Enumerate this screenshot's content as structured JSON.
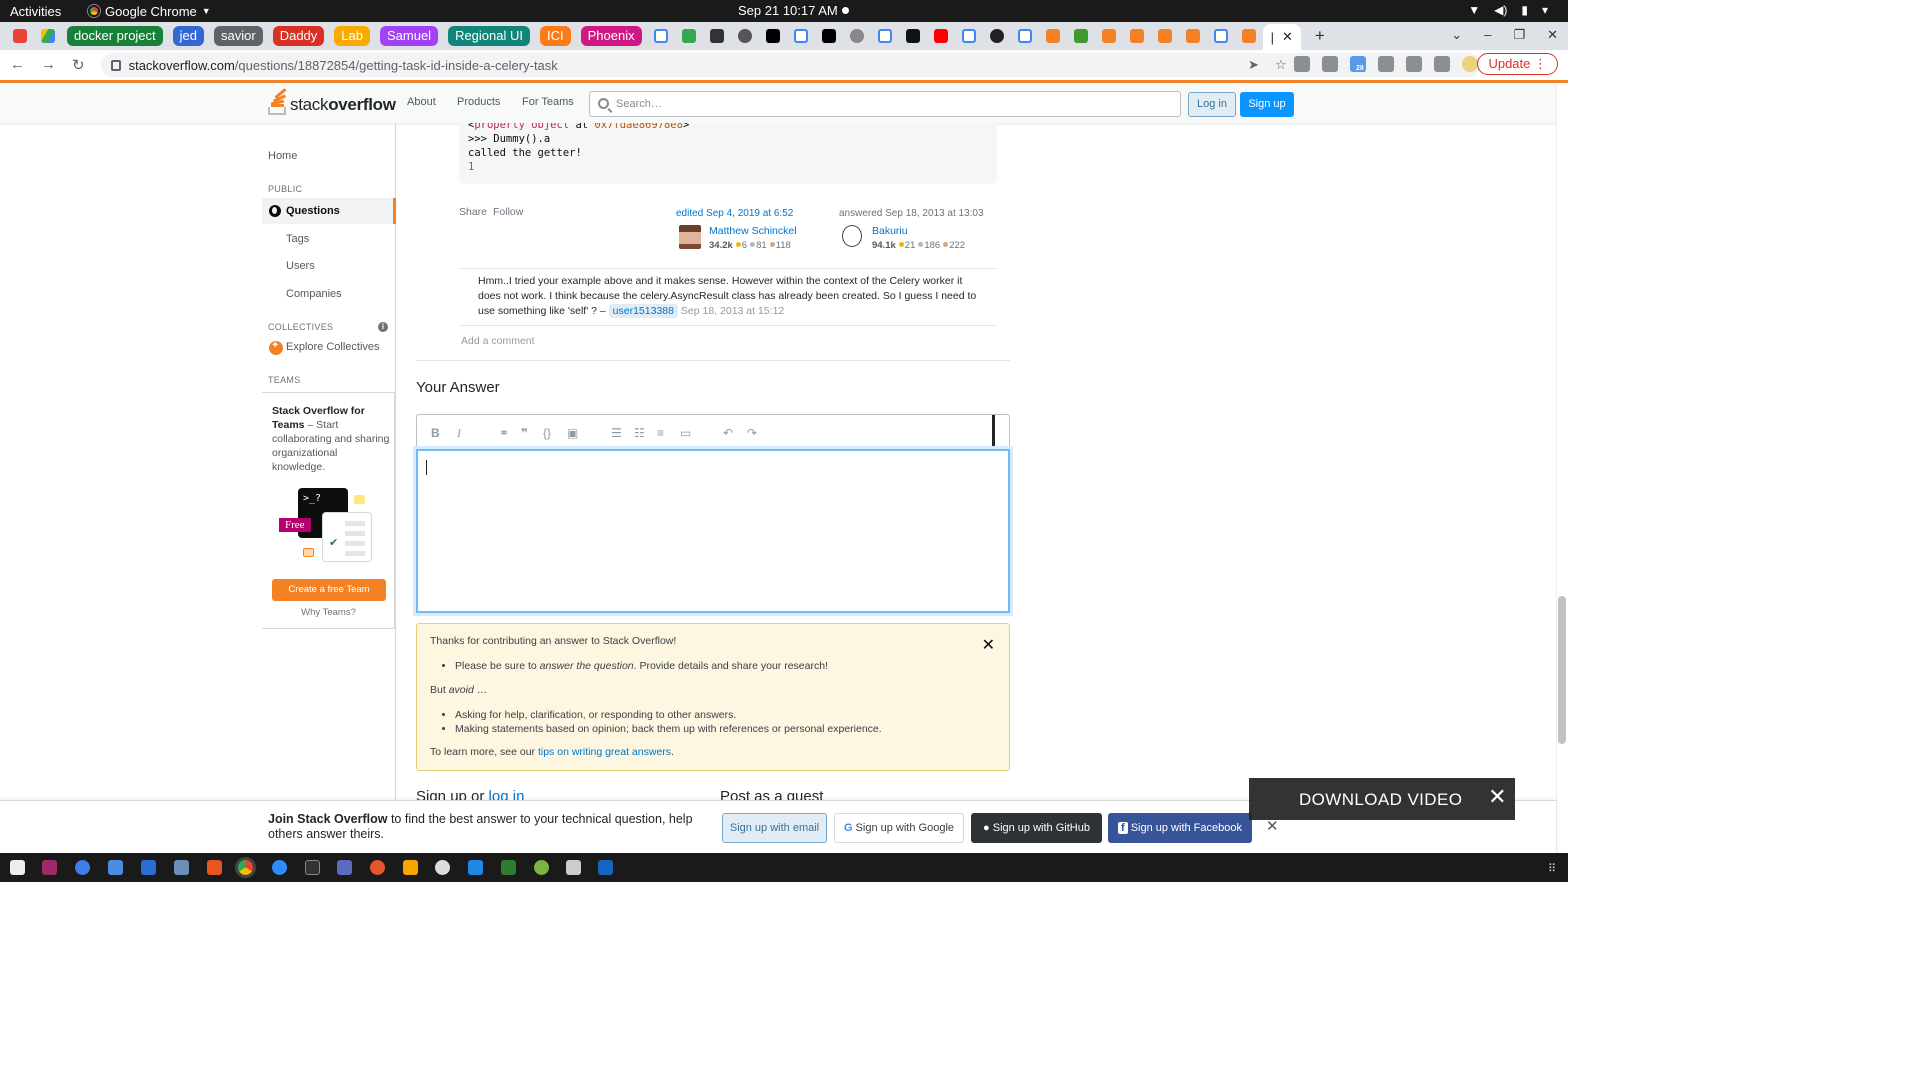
{
  "system": {
    "activities": "Activities",
    "app_name": "Google Chrome",
    "clock": "Sep 21  10:17 AM"
  },
  "browser": {
    "tab_groups": [
      {
        "label": "docker project",
        "color": "#188038"
      },
      {
        "label": "jed",
        "color": "#3367d6"
      },
      {
        "label": "savior",
        "color": "#5f6368"
      },
      {
        "label": "Daddy",
        "color": "#d93025"
      },
      {
        "label": "Lab",
        "color": "#f9ab00"
      },
      {
        "label": "Samuel",
        "color": "#a142f4"
      },
      {
        "label": "Regional UI",
        "color": "#12857a"
      },
      {
        "label": "ICI",
        "color": "#fa7b17"
      },
      {
        "label": "Phoenix",
        "color": "#d01884"
      }
    ],
    "active_tab_label": "|",
    "url_domain": "stackoverflow.com",
    "url_path": "/questions/18872854/getting-task-id-inside-a-celery-task",
    "update_button": "Update",
    "extension_badge": "28"
  },
  "so_header": {
    "logo_prefix": "stack",
    "logo_suffix": "overflow",
    "nav": [
      "About",
      "Products",
      "For Teams"
    ],
    "search_placeholder": "Search…",
    "login": "Log in",
    "signup": "Sign up"
  },
  "sidebar": {
    "home": "Home",
    "public_heading": "PUBLIC",
    "questions": "Questions",
    "tags": "Tags",
    "users": "Users",
    "companies": "Companies",
    "collectives_heading": "COLLECTIVES",
    "explore_collectives": "Explore Collectives",
    "teams_heading": "TEAMS",
    "teams_title": "Stack Overflow for Teams",
    "teams_body": " – Start collaborating and sharing organizational knowledge.",
    "free_badge": "Free",
    "terminal_text": ">_?",
    "create_team": "Create a free Team",
    "why_teams": "Why Teams?"
  },
  "answer": {
    "code_lines": [
      {
        "prefix": "<",
        "kw": "property object",
        "mid": " at ",
        "num": "0x7fdae86978e8",
        "suffix": ">"
      },
      {
        "text": ">>> Dummy().a"
      },
      {
        "text": "called the getter!"
      },
      {
        "num_only": "1"
      }
    ],
    "share": "Share",
    "follow": "Follow",
    "edited_label": "edited Sep 4, 2019 at 6:52",
    "editor": {
      "name": "Matthew Schinckel",
      "rep": "34.2k",
      "gold": "6",
      "silver": "81",
      "bronze": "118"
    },
    "answered_label": "answered Sep 18, 2013 at 13:03",
    "author": {
      "name": "Bakuriu",
      "rep": "94.1k",
      "gold": "21",
      "silver": "186",
      "bronze": "222"
    }
  },
  "comment": {
    "text": "Hmm..I tried your example above and it makes sense. However within the context of the Celery worker it does not work. I think because the celery.AsyncResult class has already been created. So I guess I need to use something like 'self' ? – ",
    "user": "user1513388",
    "date": "Sep 18, 2013 at 15:12",
    "add_comment": "Add a comment"
  },
  "your_answer": {
    "heading": "Your Answer"
  },
  "notice": {
    "intro": "Thanks for contributing an answer to Stack Overflow!",
    "bullet1_pre": "Please be sure to ",
    "bullet1_em": "answer the question",
    "bullet1_post": ". Provide details and share your research!",
    "but_pre": "But ",
    "but_em": "avoid",
    "but_post": " …",
    "avoid1": "Asking for help, clarification, or responding to other answers.",
    "avoid2": "Making statements based on opinion; back them up with references or personal experience.",
    "learn_pre": "To learn more, see our ",
    "learn_link": "tips on writing great answers",
    "learn_post": "."
  },
  "below": {
    "signup_pre": "Sign up or ",
    "signup_link": "log in",
    "guest": "Post as a guest"
  },
  "join_bar": {
    "bold": "Join Stack Overflow",
    "rest": " to find the best answer to your technical question, help others answer theirs.",
    "email": "Sign up with email",
    "google": "Sign up with Google",
    "github": "Sign up with GitHub",
    "facebook": "Sign up with Facebook"
  },
  "download_video": "DOWNLOAD VIDEO"
}
